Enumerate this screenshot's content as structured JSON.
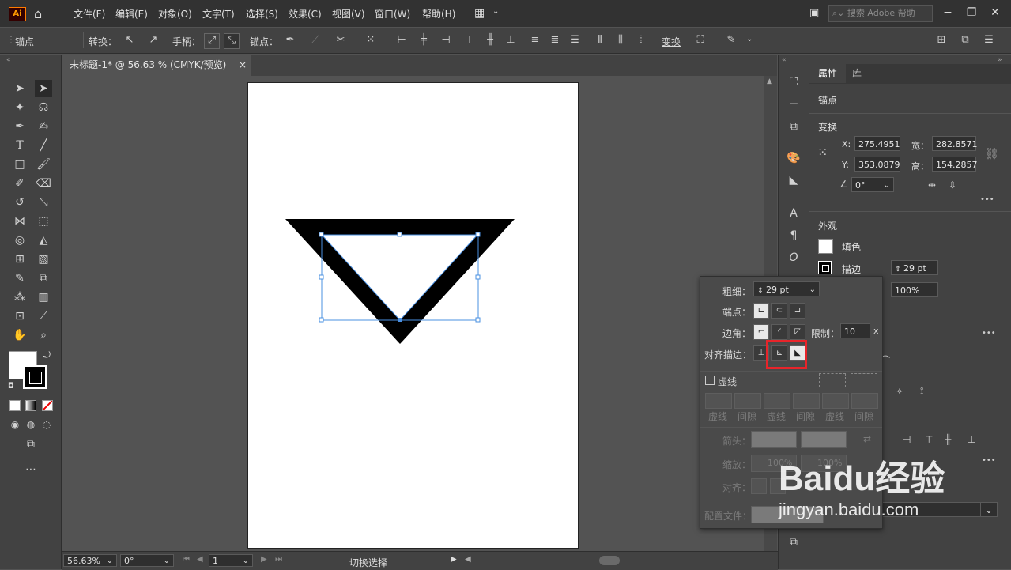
{
  "app": {
    "logo_text": "Ai"
  },
  "menu": [
    "文件(F)",
    "编辑(E)",
    "对象(O)",
    "文字(T)",
    "选择(S)",
    "效果(C)",
    "视图(V)",
    "窗口(W)",
    "帮助(H)"
  ],
  "search": {
    "placeholder": "搜索 Adobe 帮助"
  },
  "control_bar": {
    "anchor_label": "锚点",
    "convert_label": "转换：",
    "handle_label": "手柄：",
    "anchor_point_label": "锚点：",
    "transform_label": "变换"
  },
  "document_tab": {
    "title": "未标题-1* @ 56.63 % (CMYK/预览)",
    "close": "×"
  },
  "right_panel": {
    "tabs": [
      "属性",
      "库"
    ],
    "section_anchor": "锚点",
    "section_transform": "变换",
    "x_label": "X:",
    "x_value": "275.4951",
    "y_label": "Y:",
    "y_value": "353.0879",
    "w_label": "宽：",
    "w_value": "282.8571",
    "h_label": "高：",
    "h_value": "154.2857",
    "angle_value": "0°",
    "section_appearance": "外观",
    "fill_label": "填色",
    "stroke_label": "描边",
    "stroke_weight": "29 pt",
    "opacity": "100%",
    "more": "•••"
  },
  "stroke_popup": {
    "weight_label": "粗细：",
    "weight_value": "29 pt",
    "cap_label": "端点：",
    "corner_label": "边角：",
    "limit_label": "限制：",
    "limit_value": "10",
    "limit_unit": "x",
    "align_label": "对齐描边：",
    "dashed_label": "虚线",
    "dash_labels": [
      "虚线",
      "间隙",
      "虚线",
      "间隙",
      "虚线",
      "间隙"
    ],
    "arrow_label": "箭头：",
    "scale_label": "缩放：",
    "scale_value1": "100%",
    "scale_value2": "100%",
    "align2_label": "对齐：",
    "profile_label": "配置文件："
  },
  "status_bar": {
    "zoom": "56.63%",
    "rotate": "0°",
    "page": "1",
    "tool": "切换选择"
  },
  "watermark": {
    "brand": "Baidu经验",
    "url": "jingyan.baidu.com"
  },
  "colors": {
    "accent": "#4a90e2",
    "highlight": "#e8242a",
    "fill": "#ffffff",
    "stroke": "#000000"
  }
}
